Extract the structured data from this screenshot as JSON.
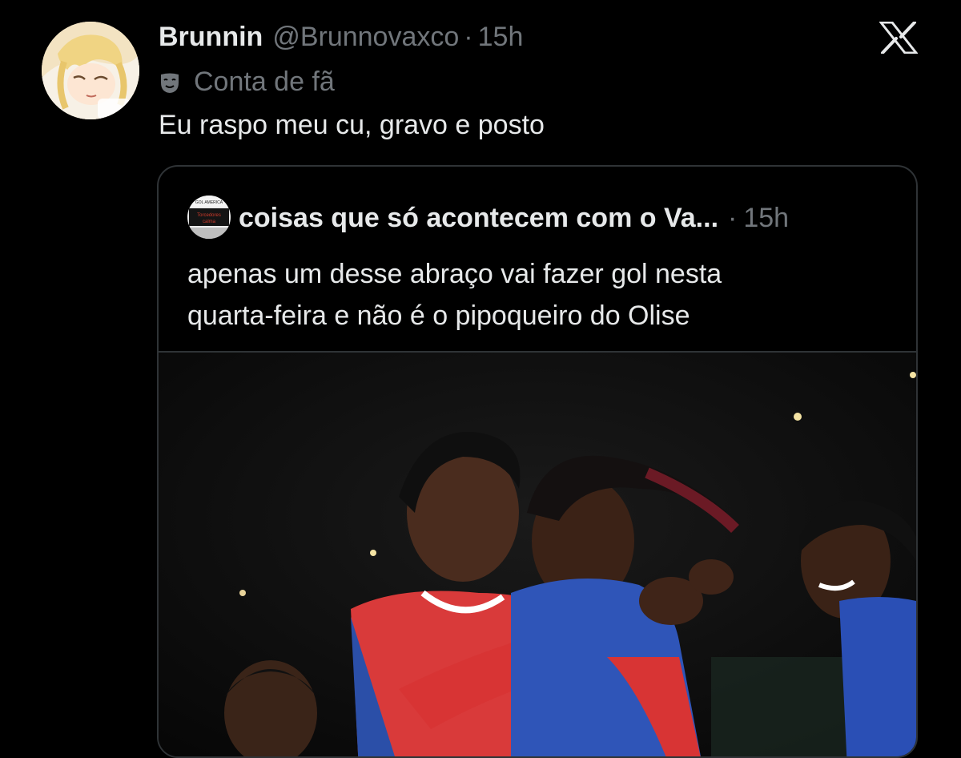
{
  "tweet": {
    "display_name": "Brunnin",
    "handle": "@Brunnovaxco",
    "separator": "·",
    "time": "15h",
    "badge_label": "Conta de fã",
    "badge_icon": "theater-mask-icon",
    "text": "Eu raspo meu cu, gravo e posto"
  },
  "brand": {
    "logo_icon": "x-logo-icon"
  },
  "quoted": {
    "display_name": "coisas que só acontecem com o Va...",
    "separator": "·",
    "time": "15h",
    "avatar_text_top": "GOL AMERICA",
    "avatar_text_mid": "Torcedores",
    "avatar_text_bot": "calma",
    "text_line1": "apenas um desse abraço vai fazer gol nesta",
    "text_line2": "quarta-feira e não é o pipoqueiro do Olise"
  },
  "colors": {
    "background": "#000000",
    "primary_text": "#e7e9ea",
    "secondary_text": "#71767b",
    "border": "#2f3336"
  }
}
